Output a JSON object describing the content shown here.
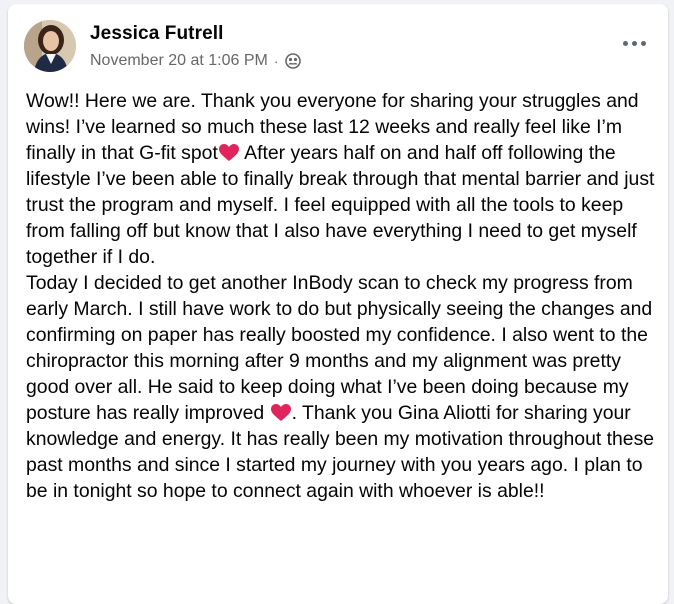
{
  "post": {
    "author": "Jessica Futrell",
    "timestamp": "November 20 at 1:06 PM",
    "separator": "·",
    "audience_icon": "group-audience-icon",
    "more_icon": "more-options-icon",
    "paragraph1_a": "Wow!! Here we are. Thank you everyone for sharing your struggles and wins! I’ve learned so much these last 12 weeks and really feel like I’m finally in that G-fit spot",
    "paragraph1_b": " After years half on and half off following the lifestyle I’ve been able to finally break through that mental barrier and just trust the program and myself. I feel equipped with all the tools to keep from falling off but know that I also have everything I need to get myself together if I do.",
    "paragraph2_a": "Today I decided to get another InBody scan to check my progress from early March. I still have work to do but physically seeing the changes and confirming on paper has really boosted my confidence. I also went to the chiropractor this morning after 9 months and my alignment was pretty good over all. He said to keep doing what I’ve  been doing because my posture has really improved ",
    "paragraph2_b": ". Thank you Gina Aliotti for sharing your knowledge and energy. It has really been my motivation throughout these past months and since I started my journey with you years ago. I plan to be in tonight so hope to connect again with whoever is able!!",
    "emoji": "red-heart-icon"
  },
  "colors": {
    "card_bg": "#ffffff",
    "page_bg": "#f0f2f5",
    "text_primary": "#050505",
    "text_secondary": "#65676b",
    "heart": "#e0245e"
  }
}
